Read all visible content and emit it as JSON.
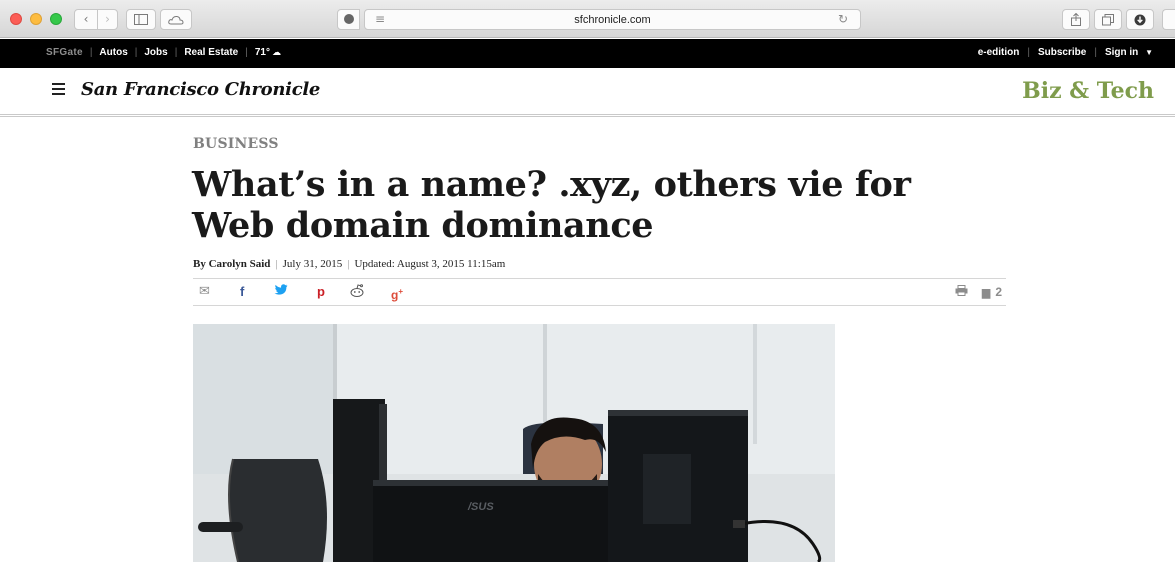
{
  "browser": {
    "url": "sfchronicle.com",
    "icons": {
      "back": "chevron-left-icon",
      "forward": "chevron-right-icon",
      "sidebar": "sidebar-icon",
      "cloud_tabs": "cloud-icon",
      "reader": "reader-icon",
      "reload": "reload-icon",
      "share": "share-icon",
      "tabs": "tabs-overview-icon",
      "downloads": "downloads-icon"
    }
  },
  "topbar": {
    "brand": "SFGate",
    "links": [
      "Autos",
      "Jobs",
      "Real Estate"
    ],
    "weather": "71°",
    "right_links": [
      "e-edition",
      "Subscribe",
      "Sign in"
    ]
  },
  "masthead": {
    "logo": "San Francisco Chronicle",
    "section": "Biz & Tech"
  },
  "article": {
    "kicker": "BUSINESS",
    "headline": "What’s in a name? .xyz, others vie for Web domain dominance",
    "author": "By Carolyn Said",
    "date": "July 31, 2015",
    "updated": "Updated: August 3, 2015 11:15am",
    "comment_count": "2"
  },
  "share": {
    "icons": [
      "email-icon",
      "facebook-icon",
      "twitter-icon",
      "pinterest-icon",
      "reddit-icon",
      "google-plus-icon",
      "print-icon",
      "comments-icon"
    ]
  },
  "photo": {
    "monitor_brand": "/SUS"
  },
  "colors": {
    "section_accent": "#7f9c4c",
    "topbar_bg": "#000000",
    "facebook": "#3b5998",
    "twitter": "#1da1f2",
    "pinterest": "#cb2027",
    "google_plus": "#dd4b39"
  }
}
